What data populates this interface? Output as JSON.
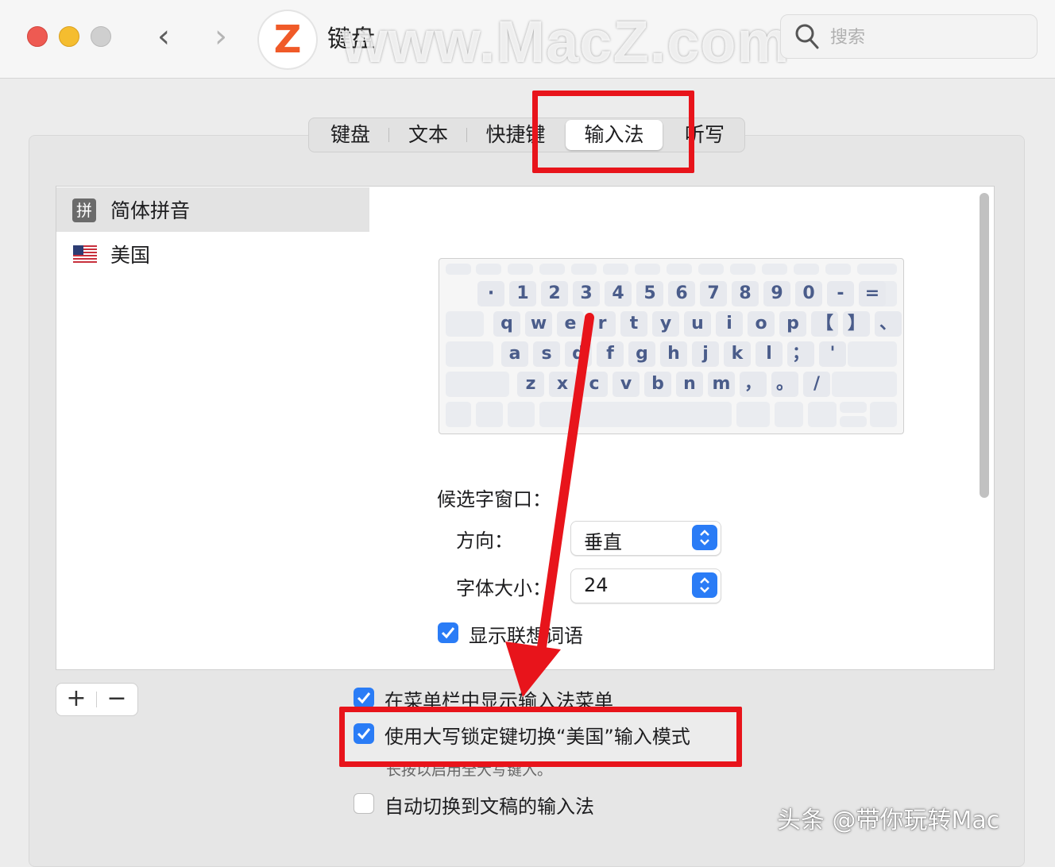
{
  "window": {
    "title": "键盘",
    "watermark": "www.MacZ.com",
    "logo_letter": "Z",
    "back_glyph": "‹",
    "forward_glyph": "›",
    "search_placeholder": "搜索"
  },
  "tabs": [
    {
      "label": "键盘",
      "active": false
    },
    {
      "label": "文本",
      "active": false
    },
    {
      "label": "快捷键",
      "active": false
    },
    {
      "label": "输入法",
      "active": true
    },
    {
      "label": "听写",
      "active": false
    }
  ],
  "input_sources": [
    {
      "label": "简体拼音",
      "icon": "pinyin-icon",
      "icon_glyph": "拼",
      "selected": true
    },
    {
      "label": "美国",
      "icon": "us-flag-icon",
      "selected": false
    }
  ],
  "keyboard": {
    "row1": [
      "·",
      "1",
      "2",
      "3",
      "4",
      "5",
      "6",
      "7",
      "8",
      "9",
      "0",
      "-",
      "="
    ],
    "row2": [
      "q",
      "w",
      "e",
      "r",
      "t",
      "y",
      "u",
      "i",
      "o",
      "p",
      "【",
      "】",
      "、"
    ],
    "row3": [
      "a",
      "s",
      "d",
      "f",
      "g",
      "h",
      "j",
      "k",
      "l",
      "；",
      "'"
    ],
    "row4": [
      "z",
      "x",
      "c",
      "v",
      "b",
      "n",
      "m",
      "，",
      "。",
      "/"
    ]
  },
  "candidate_window": {
    "label": "候选字窗口：",
    "direction_label": "方向：",
    "direction_value": "垂直",
    "font_size_label": "字体大小：",
    "font_size_value": "24"
  },
  "options": {
    "show_associated_words": {
      "label": "显示联想词语",
      "checked": true
    },
    "show_menu_in_menubar": {
      "label": "在菜单栏中显示输入法菜单",
      "checked": true
    },
    "capslock_switch": {
      "label": "使用大写锁定键切换“美国”输入模式",
      "checked": true
    },
    "capslock_note": "长按以启用全大写键入。",
    "auto_switch": {
      "label": "自动切换到文稿的输入法",
      "checked": false
    }
  },
  "buttons": {
    "add": "+",
    "remove": "−"
  },
  "signature": "头条 @带你玩转Mac",
  "colors": {
    "accent": "#2a7cf6",
    "highlight": "#e8141b",
    "key_text": "#4a5c8a"
  }
}
